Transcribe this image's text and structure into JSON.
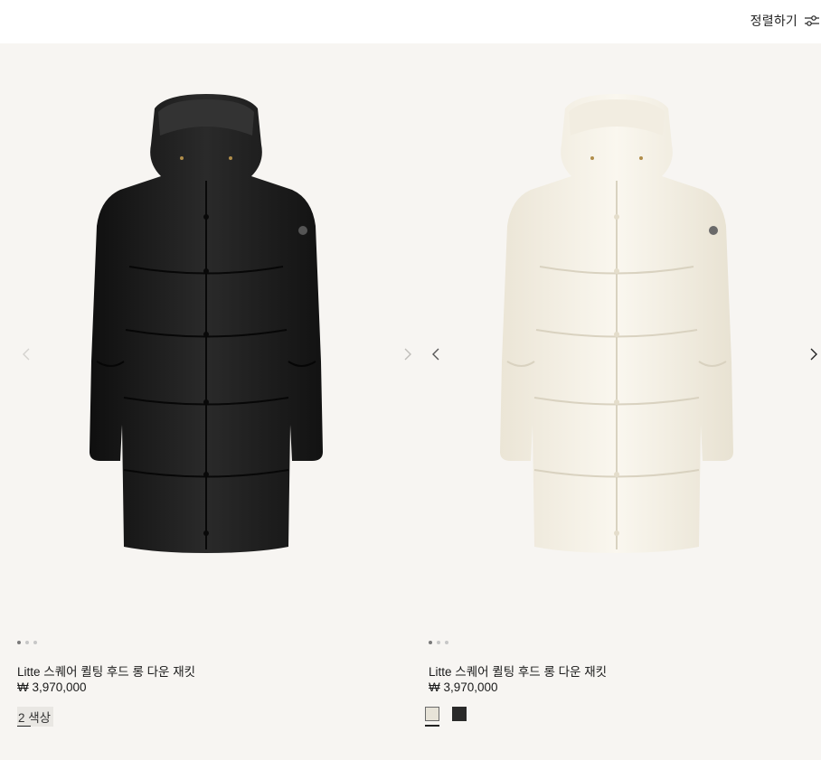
{
  "header": {
    "sort_label": "정렬하기",
    "sort_icon": "sliders-icon"
  },
  "products": [
    {
      "name": "Litte 스퀘어 퀼팅 후드 롱 다운 재킷",
      "price": "₩ 3,970,000",
      "colors_label": "2 색상",
      "image_color": "#1a1a1a",
      "carousel_dots": 3,
      "active_dot": 1
    },
    {
      "name": "Litte 스퀘어 퀼팅 후드 롱 다운 재킷",
      "price": "₩ 3,970,000",
      "image_color": "#f0ebdf",
      "carousel_dots": 3,
      "active_dot": 1,
      "swatches": [
        {
          "name": "ivory",
          "color": "#e7e3d8",
          "selected": true
        },
        {
          "name": "black",
          "color": "#2a2a2a",
          "selected": false
        }
      ]
    }
  ]
}
